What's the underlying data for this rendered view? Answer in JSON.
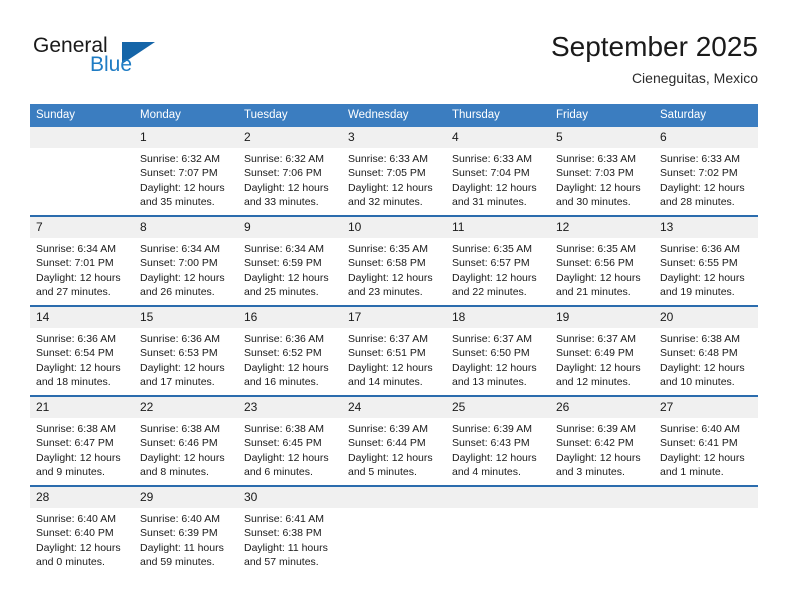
{
  "brand": {
    "name_part1": "General",
    "name_part2": "Blue",
    "flag_icon": "triangle-flag-icon",
    "accent_color": "#1f7cc4"
  },
  "header": {
    "title": "September 2025",
    "subtitle": "Cieneguitas, Mexico"
  },
  "calendar": {
    "header_bg": "#3b7dc0",
    "daynum_bg": "#f0f0f0",
    "row_divider_color": "#2b6cad",
    "weekday_headers": [
      "Sunday",
      "Monday",
      "Tuesday",
      "Wednesday",
      "Thursday",
      "Friday",
      "Saturday"
    ],
    "weeks": [
      [
        {
          "day": "",
          "sunrise": "",
          "sunset": "",
          "daylight": ""
        },
        {
          "day": "1",
          "sunrise": "Sunrise: 6:32 AM",
          "sunset": "Sunset: 7:07 PM",
          "daylight": "Daylight: 12 hours and 35 minutes."
        },
        {
          "day": "2",
          "sunrise": "Sunrise: 6:32 AM",
          "sunset": "Sunset: 7:06 PM",
          "daylight": "Daylight: 12 hours and 33 minutes."
        },
        {
          "day": "3",
          "sunrise": "Sunrise: 6:33 AM",
          "sunset": "Sunset: 7:05 PM",
          "daylight": "Daylight: 12 hours and 32 minutes."
        },
        {
          "day": "4",
          "sunrise": "Sunrise: 6:33 AM",
          "sunset": "Sunset: 7:04 PM",
          "daylight": "Daylight: 12 hours and 31 minutes."
        },
        {
          "day": "5",
          "sunrise": "Sunrise: 6:33 AM",
          "sunset": "Sunset: 7:03 PM",
          "daylight": "Daylight: 12 hours and 30 minutes."
        },
        {
          "day": "6",
          "sunrise": "Sunrise: 6:33 AM",
          "sunset": "Sunset: 7:02 PM",
          "daylight": "Daylight: 12 hours and 28 minutes."
        }
      ],
      [
        {
          "day": "7",
          "sunrise": "Sunrise: 6:34 AM",
          "sunset": "Sunset: 7:01 PM",
          "daylight": "Daylight: 12 hours and 27 minutes."
        },
        {
          "day": "8",
          "sunrise": "Sunrise: 6:34 AM",
          "sunset": "Sunset: 7:00 PM",
          "daylight": "Daylight: 12 hours and 26 minutes."
        },
        {
          "day": "9",
          "sunrise": "Sunrise: 6:34 AM",
          "sunset": "Sunset: 6:59 PM",
          "daylight": "Daylight: 12 hours and 25 minutes."
        },
        {
          "day": "10",
          "sunrise": "Sunrise: 6:35 AM",
          "sunset": "Sunset: 6:58 PM",
          "daylight": "Daylight: 12 hours and 23 minutes."
        },
        {
          "day": "11",
          "sunrise": "Sunrise: 6:35 AM",
          "sunset": "Sunset: 6:57 PM",
          "daylight": "Daylight: 12 hours and 22 minutes."
        },
        {
          "day": "12",
          "sunrise": "Sunrise: 6:35 AM",
          "sunset": "Sunset: 6:56 PM",
          "daylight": "Daylight: 12 hours and 21 minutes."
        },
        {
          "day": "13",
          "sunrise": "Sunrise: 6:36 AM",
          "sunset": "Sunset: 6:55 PM",
          "daylight": "Daylight: 12 hours and 19 minutes."
        }
      ],
      [
        {
          "day": "14",
          "sunrise": "Sunrise: 6:36 AM",
          "sunset": "Sunset: 6:54 PM",
          "daylight": "Daylight: 12 hours and 18 minutes."
        },
        {
          "day": "15",
          "sunrise": "Sunrise: 6:36 AM",
          "sunset": "Sunset: 6:53 PM",
          "daylight": "Daylight: 12 hours and 17 minutes."
        },
        {
          "day": "16",
          "sunrise": "Sunrise: 6:36 AM",
          "sunset": "Sunset: 6:52 PM",
          "daylight": "Daylight: 12 hours and 16 minutes."
        },
        {
          "day": "17",
          "sunrise": "Sunrise: 6:37 AM",
          "sunset": "Sunset: 6:51 PM",
          "daylight": "Daylight: 12 hours and 14 minutes."
        },
        {
          "day": "18",
          "sunrise": "Sunrise: 6:37 AM",
          "sunset": "Sunset: 6:50 PM",
          "daylight": "Daylight: 12 hours and 13 minutes."
        },
        {
          "day": "19",
          "sunrise": "Sunrise: 6:37 AM",
          "sunset": "Sunset: 6:49 PM",
          "daylight": "Daylight: 12 hours and 12 minutes."
        },
        {
          "day": "20",
          "sunrise": "Sunrise: 6:38 AM",
          "sunset": "Sunset: 6:48 PM",
          "daylight": "Daylight: 12 hours and 10 minutes."
        }
      ],
      [
        {
          "day": "21",
          "sunrise": "Sunrise: 6:38 AM",
          "sunset": "Sunset: 6:47 PM",
          "daylight": "Daylight: 12 hours and 9 minutes."
        },
        {
          "day": "22",
          "sunrise": "Sunrise: 6:38 AM",
          "sunset": "Sunset: 6:46 PM",
          "daylight": "Daylight: 12 hours and 8 minutes."
        },
        {
          "day": "23",
          "sunrise": "Sunrise: 6:38 AM",
          "sunset": "Sunset: 6:45 PM",
          "daylight": "Daylight: 12 hours and 6 minutes."
        },
        {
          "day": "24",
          "sunrise": "Sunrise: 6:39 AM",
          "sunset": "Sunset: 6:44 PM",
          "daylight": "Daylight: 12 hours and 5 minutes."
        },
        {
          "day": "25",
          "sunrise": "Sunrise: 6:39 AM",
          "sunset": "Sunset: 6:43 PM",
          "daylight": "Daylight: 12 hours and 4 minutes."
        },
        {
          "day": "26",
          "sunrise": "Sunrise: 6:39 AM",
          "sunset": "Sunset: 6:42 PM",
          "daylight": "Daylight: 12 hours and 3 minutes."
        },
        {
          "day": "27",
          "sunrise": "Sunrise: 6:40 AM",
          "sunset": "Sunset: 6:41 PM",
          "daylight": "Daylight: 12 hours and 1 minute."
        }
      ],
      [
        {
          "day": "28",
          "sunrise": "Sunrise: 6:40 AM",
          "sunset": "Sunset: 6:40 PM",
          "daylight": "Daylight: 12 hours and 0 minutes."
        },
        {
          "day": "29",
          "sunrise": "Sunrise: 6:40 AM",
          "sunset": "Sunset: 6:39 PM",
          "daylight": "Daylight: 11 hours and 59 minutes."
        },
        {
          "day": "30",
          "sunrise": "Sunrise: 6:41 AM",
          "sunset": "Sunset: 6:38 PM",
          "daylight": "Daylight: 11 hours and 57 minutes."
        },
        {
          "day": "",
          "sunrise": "",
          "sunset": "",
          "daylight": ""
        },
        {
          "day": "",
          "sunrise": "",
          "sunset": "",
          "daylight": ""
        },
        {
          "day": "",
          "sunrise": "",
          "sunset": "",
          "daylight": ""
        },
        {
          "day": "",
          "sunrise": "",
          "sunset": "",
          "daylight": ""
        }
      ]
    ]
  }
}
